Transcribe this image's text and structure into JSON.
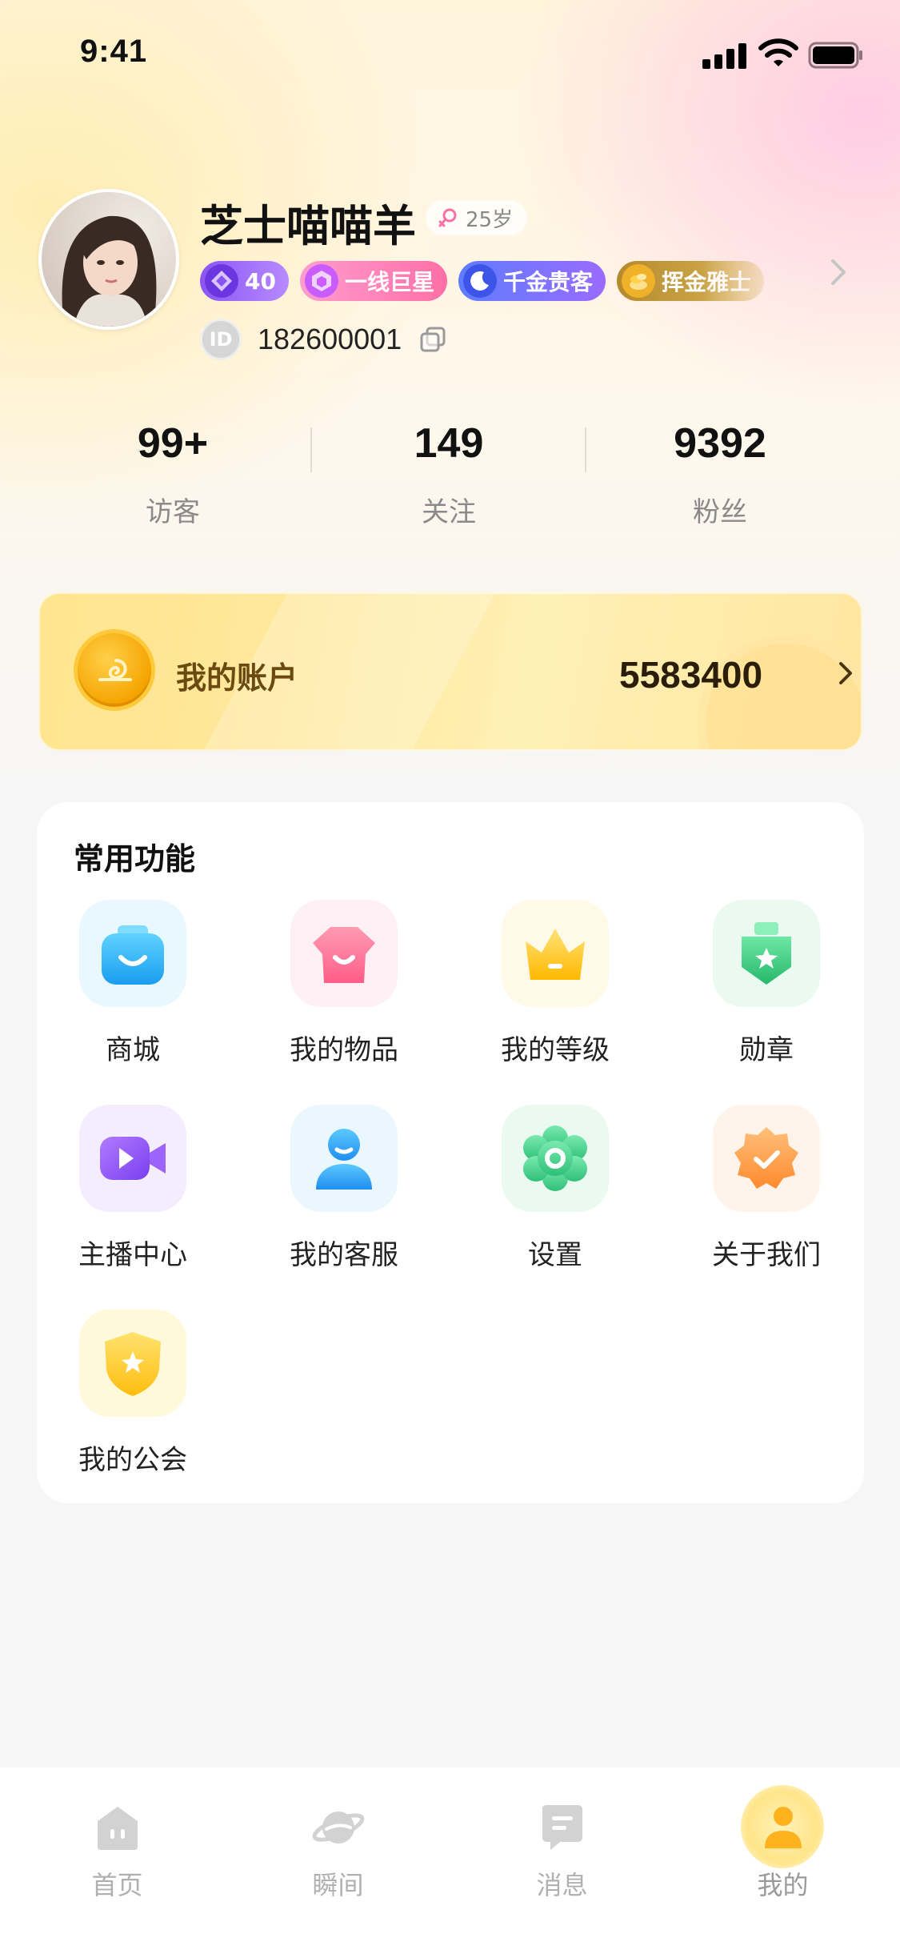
{
  "status_bar": {
    "time": "9:41"
  },
  "profile": {
    "nickname": "芝士喵喵羊",
    "age": "25岁",
    "gender_icon": "female-icon",
    "badges": [
      {
        "icon": "diamond-icon",
        "label": "40"
      },
      {
        "icon": "hexagon-star-icon",
        "label": "一线巨星"
      },
      {
        "icon": "moon-icon",
        "label": "千金贵客"
      },
      {
        "icon": "gold-pile-icon",
        "label": "挥金雅士"
      }
    ],
    "id_badge": "ID",
    "id_number": "182600001"
  },
  "stats": [
    {
      "value": "99+",
      "label": "访客"
    },
    {
      "value": "149",
      "label": "关注"
    },
    {
      "value": "9392",
      "label": "粉丝"
    }
  ],
  "account": {
    "label": "我的账户",
    "value": "5583400"
  },
  "functions": {
    "title": "常用功能",
    "items": [
      {
        "label": "商城",
        "icon": "shop-bag-icon",
        "bg": "#e9f8ff",
        "color": "#2bb0f5"
      },
      {
        "label": "我的物品",
        "icon": "clothes-icon",
        "bg": "#fff0f5",
        "color": "#ff6e95"
      },
      {
        "label": "我的等级",
        "icon": "crown-icon",
        "bg": "#fff9e8",
        "color": "#ffc71e"
      },
      {
        "label": "勋章",
        "icon": "medal-icon",
        "bg": "#eafaf0",
        "color": "#33c97a"
      },
      {
        "label": "主播中心",
        "icon": "video-camera-icon",
        "bg": "#f3edff",
        "color": "#8b52f5"
      },
      {
        "label": "我的客服",
        "icon": "customer-service-icon",
        "bg": "#eaf7ff",
        "color": "#2a9cf2"
      },
      {
        "label": "设置",
        "icon": "gear-flower-icon",
        "bg": "#eafaf0",
        "color": "#3fcf84"
      },
      {
        "label": "关于我们",
        "icon": "check-badge-icon",
        "bg": "#fff3ea",
        "color": "#ff9a3c"
      },
      {
        "label": "我的公会",
        "icon": "guild-shield-icon",
        "bg": "#fff9dc",
        "color": "#ffc81a"
      }
    ]
  },
  "tabbar": {
    "items": [
      {
        "label": "首页",
        "icon": "home-chat-icon",
        "active": false
      },
      {
        "label": "瞬间",
        "icon": "planet-icon",
        "active": false
      },
      {
        "label": "消息",
        "icon": "message-icon",
        "active": false
      },
      {
        "label": "我的",
        "icon": "profile-icon",
        "active": true
      }
    ]
  },
  "colors": {
    "accent_gold": "#ffc93c",
    "tab_inactive": "#b0b0b0",
    "tab_active_icon": "#ffb21e"
  }
}
